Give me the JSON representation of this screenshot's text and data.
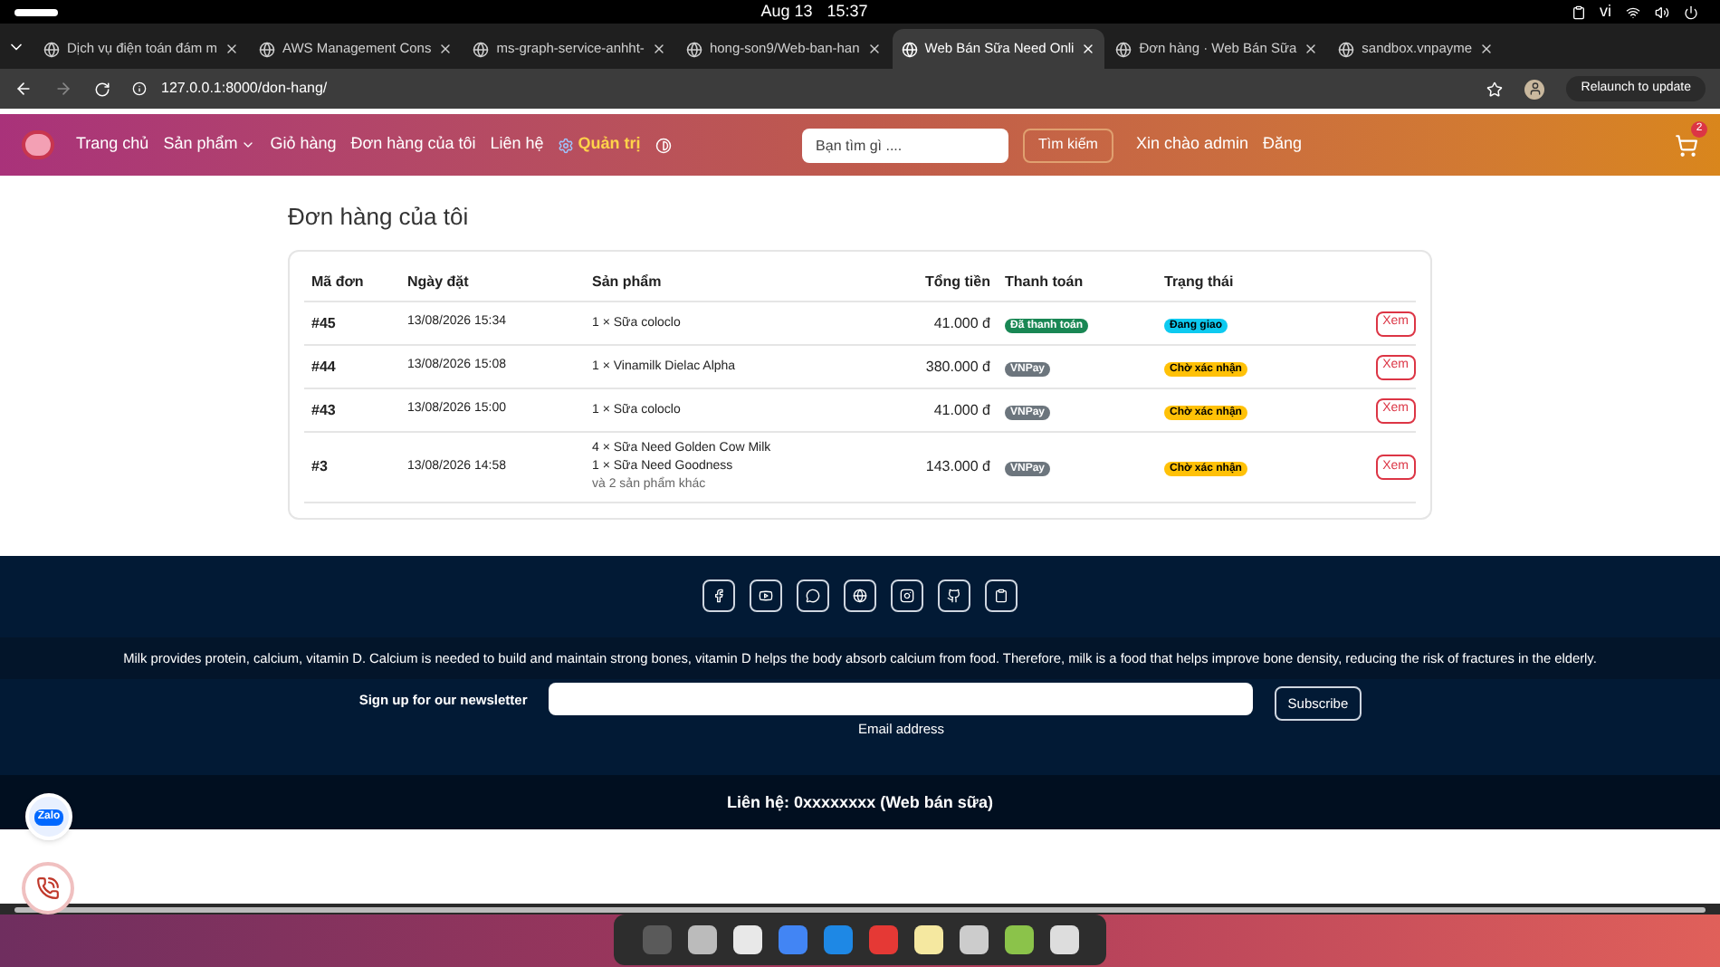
{
  "system_bar": {
    "date": "Aug 13",
    "time": "15:37",
    "language": "vi"
  },
  "tabs": [
    {
      "title": "Dịch vụ điện toán đám m",
      "selected": false
    },
    {
      "title": "AWS Management Cons",
      "selected": false
    },
    {
      "title": "ms-graph-service-anhht-",
      "selected": false
    },
    {
      "title": "hong-son9/Web-ban-han",
      "selected": false
    },
    {
      "title": "Web Bán Sữa Need Onli",
      "selected": true
    },
    {
      "title": "Đơn hàng · Web Bán Sữa",
      "selected": false
    },
    {
      "title": "sandbox.vnpayme",
      "selected": false
    }
  ],
  "address_bar": {
    "url": "127.0.0.1:8000/don-hang/",
    "update_button": "Relaunch to update"
  },
  "navbar": {
    "links": [
      {
        "label": "Trang chủ",
        "dropdown": false
      },
      {
        "label": "Sản phẩm",
        "dropdown": true
      },
      {
        "label": "Giỏ hàng",
        "dropdown": false
      },
      {
        "label": "Đơn hàng của tôi",
        "dropdown": false
      },
      {
        "label": "Liên hệ",
        "dropdown": false
      }
    ],
    "admin_link": "Quản trị",
    "search": {
      "placeholder": "Bạn tìm gì ....",
      "button": "Tìm kiếm"
    },
    "greeting": "Xin chào admin",
    "logout": "Đăng",
    "cart_count": "2"
  },
  "page_title": "Đơn hàng của tôi",
  "table": {
    "columns": [
      "Mã đơn",
      "Ngày đặt",
      "Sản phẩm",
      "Tổng tiền",
      "Thanh toán",
      "Trạng thái"
    ],
    "rows": [
      {
        "id": "#45",
        "date": "13/08/2026 15:34",
        "products": [
          "1 × Sữa coloclo"
        ],
        "total": "41.000 đ",
        "payment": {
          "label": "Đã thanh toán",
          "kind": "paid"
        },
        "status": {
          "label": "Đang giao",
          "kind": "shipping"
        },
        "action": "Xem"
      },
      {
        "id": "#44",
        "date": "13/08/2026 15:08",
        "products": [
          "1 × Vinamilk Dielac Alpha"
        ],
        "total": "380.000 đ",
        "payment": {
          "label": "VNPay",
          "kind": "method"
        },
        "status": {
          "label": "Chờ xác nhận",
          "kind": "pending"
        },
        "action": "Xem"
      },
      {
        "id": "#43",
        "date": "13/08/2026 15:00",
        "products": [
          "1 × Sữa coloclo"
        ],
        "total": "41.000 đ",
        "payment": {
          "label": "VNPay",
          "kind": "method"
        },
        "status": {
          "label": "Chờ xác nhận",
          "kind": "pending"
        },
        "action": "Xem"
      },
      {
        "id": "#3",
        "date": "13/08/2026 14:58",
        "products": [
          "4 × Sữa Need Golden Cow Milk",
          "1 × Sữa Need Goodness"
        ],
        "more": "và 2 sản phẩm khác",
        "total": "143.000 đ",
        "payment": {
          "label": "VNPay",
          "kind": "method"
        },
        "status": {
          "label": "Chờ xác nhận",
          "kind": "pending"
        },
        "action": "Xem"
      }
    ]
  },
  "footer": {
    "description": "Milk provides protein, calcium, vitamin D. Calcium is needed to build and maintain strong bones, vitamin D helps the body absorb calcium from food. Therefore, milk is a food that helps improve bone density, reducing the risk of fractures in the elderly.",
    "newsletter": {
      "label": "Sign up for our newsletter",
      "field_label": "Email address",
      "button": "Subscribe"
    },
    "contact": "Liên hệ: 0xxxxxxxx (Web bán sữa)"
  },
  "zalo_button": "Zalo"
}
